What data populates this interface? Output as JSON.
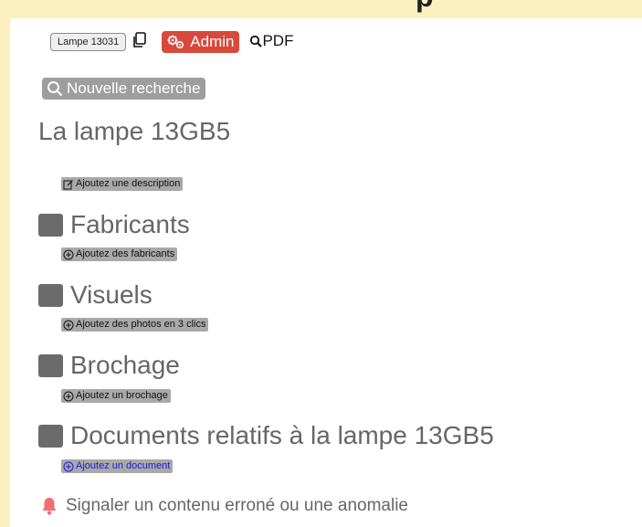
{
  "header": {
    "item_id": "Lampe 13031",
    "admin_label": "Admin",
    "pdf_label": "PDF"
  },
  "search_button": {
    "label": "Nouvelle recherche"
  },
  "page": {
    "title": "La lampe 13GB5"
  },
  "description_button": {
    "label": "Ajoutez une description"
  },
  "sections": [
    {
      "title": "Fabricants",
      "action": "Ajoutez des fabricants"
    },
    {
      "title": "Visuels",
      "action": "Ajoutez des photos en 3 clics"
    },
    {
      "title": "Brochage",
      "action": "Ajoutez un brochage"
    },
    {
      "title": "Documents relatifs à la lampe 13GB5",
      "action": "Ajoutez un document"
    }
  ],
  "report": {
    "label": "Signaler un contenu erroné ou une anomalie"
  },
  "colors": {
    "background": "#fdf0c0",
    "admin": "#d8493c",
    "section_square": "#6b6b6b",
    "bell": "#f07070",
    "doc_link": "#1a1adb"
  },
  "icons": [
    "copy-icon",
    "gears-icon",
    "search-icon",
    "edit-icon",
    "plus-circle-icon",
    "bell-icon"
  ]
}
